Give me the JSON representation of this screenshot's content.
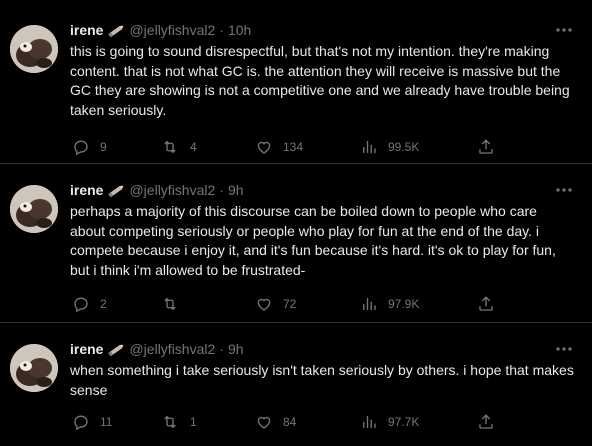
{
  "tweets": [
    {
      "name": "irene",
      "handle": "@jellyfishval2",
      "separator": "·",
      "time": "10h",
      "text": "this is going to sound disrespectful, but that's not my intention. they're making content. that is not what GC is. the attention they will receive is massive but the GC they are showing is not a competitive one and we already have trouble being taken seriously.",
      "replies": "9",
      "retweets": "4",
      "likes": "134",
      "views": "99.5K"
    },
    {
      "name": "irene",
      "handle": "@jellyfishval2",
      "separator": "·",
      "time": "9h",
      "text": "perhaps a majority of this discourse can be boiled down to people who care about competing seriously or people who play for fun at the end of the day. i compete because i enjoy it, and it's fun because it's hard. it's ok to play for fun, but i think i'm allowed to be frustrated-",
      "replies": "2",
      "retweets": "",
      "likes": "72",
      "views": "97.9K"
    },
    {
      "name": "irene",
      "handle": "@jellyfishval2",
      "separator": "·",
      "time": "9h",
      "text": "when something i take seriously isn't taken seriously by others. i hope that makes sense",
      "replies": "11",
      "retweets": "1",
      "likes": "84",
      "views": "97.7K"
    }
  ],
  "colors": {
    "background": "#000000",
    "text": "#e7e9ea",
    "muted": "#71767b",
    "divider": "#2f3336"
  },
  "icons": [
    "reply-icon",
    "retweet-icon",
    "like-icon",
    "views-icon",
    "share-icon",
    "more-icon",
    "verified-pencil-badge"
  ]
}
